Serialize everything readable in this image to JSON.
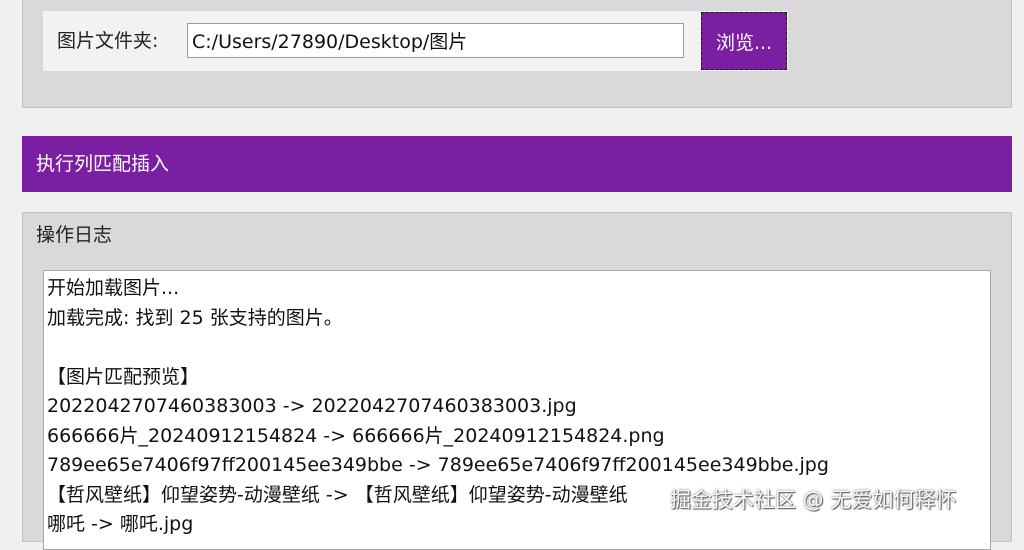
{
  "folder": {
    "label": "图片文件夹:",
    "path_value": "C:/Users/27890/Desktop/图片",
    "browse_label": "浏览..."
  },
  "action": {
    "execute_label": "执行列匹配插入"
  },
  "log": {
    "title": "操作日志",
    "lines": [
      "开始加载图片...",
      "加载完成: 找到 25 张支持的图片。",
      "",
      "【图片匹配预览】",
      "2022042707460383003 -> 2022042707460383003.jpg",
      "666666片_20240912154824 -> 666666片_20240912154824.png",
      "789ee65e7406f97ff200145ee349bbe -> 789ee65e7406f97ff200145ee349bbe.jpg",
      "【哲风壁纸】仰望姿势-动漫壁纸 -> 【哲风壁纸】仰望姿势-动漫壁纸",
      "哪吒 -> 哪吒.jpg"
    ]
  },
  "watermark": {
    "text": "掘金技术社区 @ 无爱如何释怀"
  },
  "colors": {
    "accent": "#7b1fa2",
    "panel_bg": "#d9d9d9",
    "window_bg": "#f0f0f0"
  }
}
